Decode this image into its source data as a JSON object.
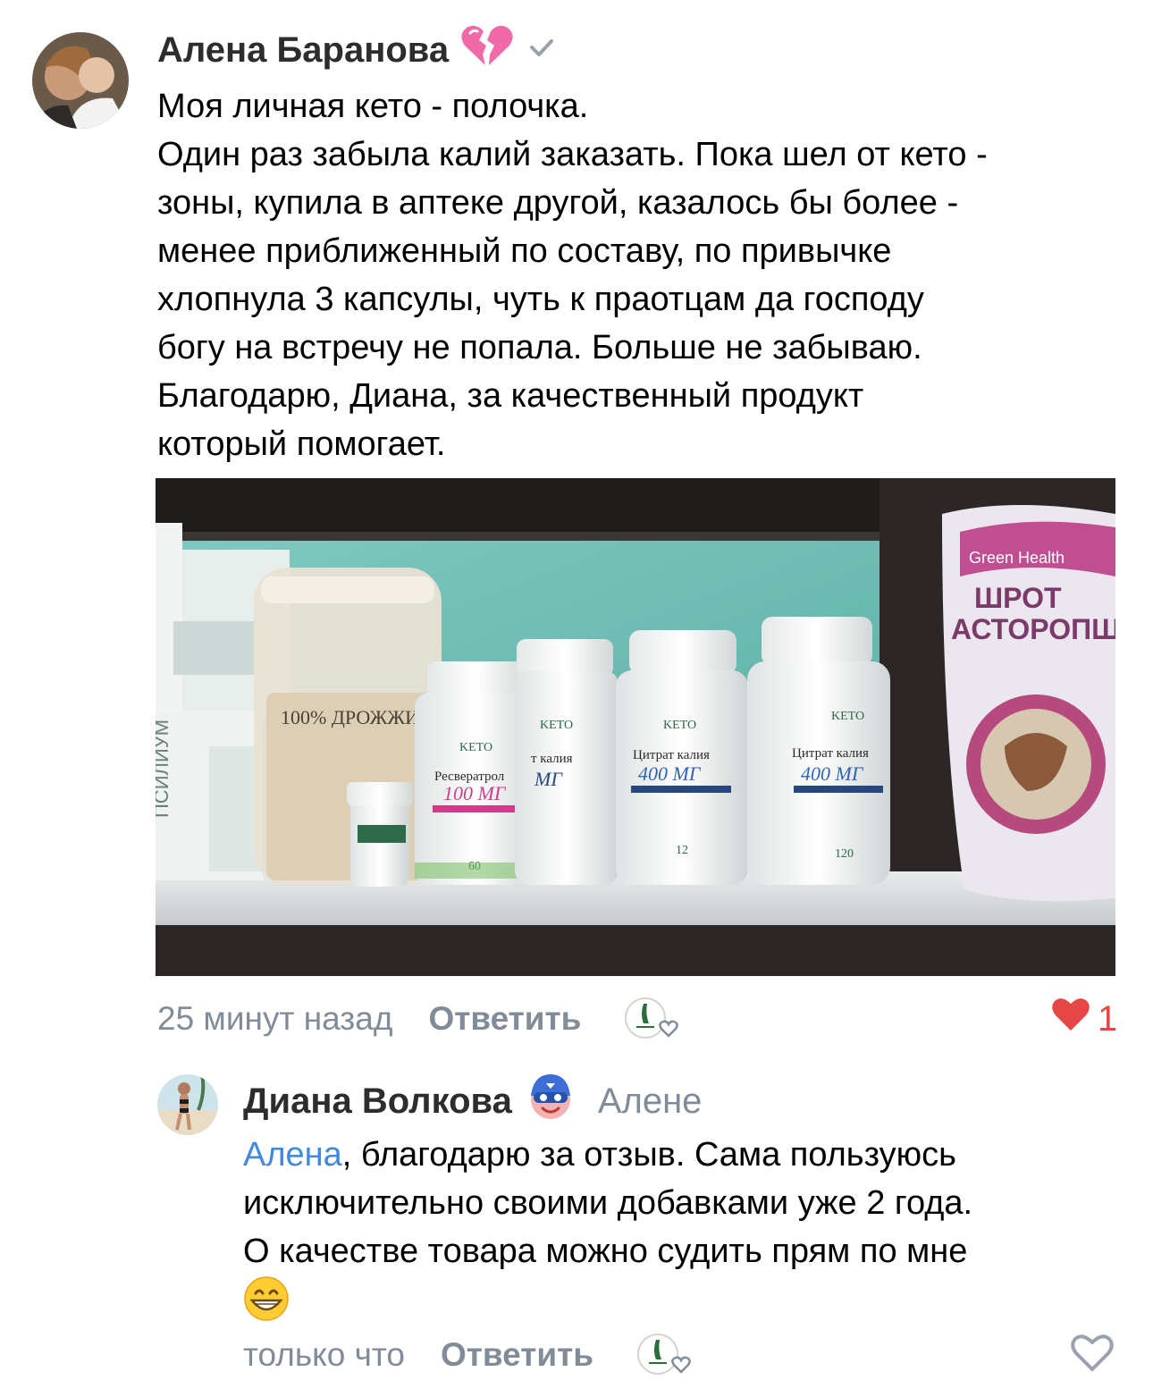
{
  "comments": [
    {
      "author": "Алена Баранова",
      "author_badge_icon": "broken-heart-icon",
      "verified_icon": "check-icon",
      "text_lines": [
        "Моя личная кето - полочка.",
        "Один раз забыла калий заказать. Пока шел от кето -",
        "зоны, купила в аптеке другой, казалось бы более -",
        "менее приближенный по составу, по привычке",
        "хлопнула 3 капсулы, чуть к праотцам да господу",
        "богу на встречу не попала. Больше не забываю.",
        "Благодарю, Диана, за качественный продукт",
        "который помогает."
      ],
      "photo": {
        "alt": "shelf with supplement jars",
        "jar_labels": [
          {
            "brand": "KETO",
            "name": "Ресвератрол",
            "dose": "100 МГ",
            "count": "60"
          },
          {
            "brand": "KETO",
            "name": "т калия",
            "dose": "МГ",
            "count": ""
          },
          {
            "brand": "KETO",
            "name": "Цитрат калия",
            "dose": "400 МГ",
            "count": "12"
          },
          {
            "brand": "KETO",
            "name": "Цитрат калия",
            "dose": "400 МГ",
            "count": "120"
          }
        ],
        "yeast_label": "100% ДРОЖЖИ НАТУРАЛЬНЫЕ",
        "bag_label_1": "ШРОТ",
        "bag_label_2": "АСТОРОПШ",
        "bag_brand": "Green Health",
        "box_label": "ПСИЛИУМ"
      },
      "time": "25 минут назад",
      "reply_label": "Ответить",
      "like_count": "1",
      "liked": true
    },
    {
      "author": "Диана Волкова",
      "author_badge_icon": "masked-emoji-icon",
      "addressee": "Алене",
      "mention": "Алена",
      "text_after_mention": ", благодарю за отзыв. Сама пользуюсь",
      "text_lines": [
        "исключительно своими добавками уже 2 года.",
        "О качестве товара можно судить прям по мне"
      ],
      "emoji": "grinning-face-icon",
      "time": "только что",
      "reply_label": "Ответить",
      "liked": false
    }
  ],
  "colors": {
    "muted": "#818c99",
    "like": "#e64646",
    "mention": "#3f8ae0"
  }
}
